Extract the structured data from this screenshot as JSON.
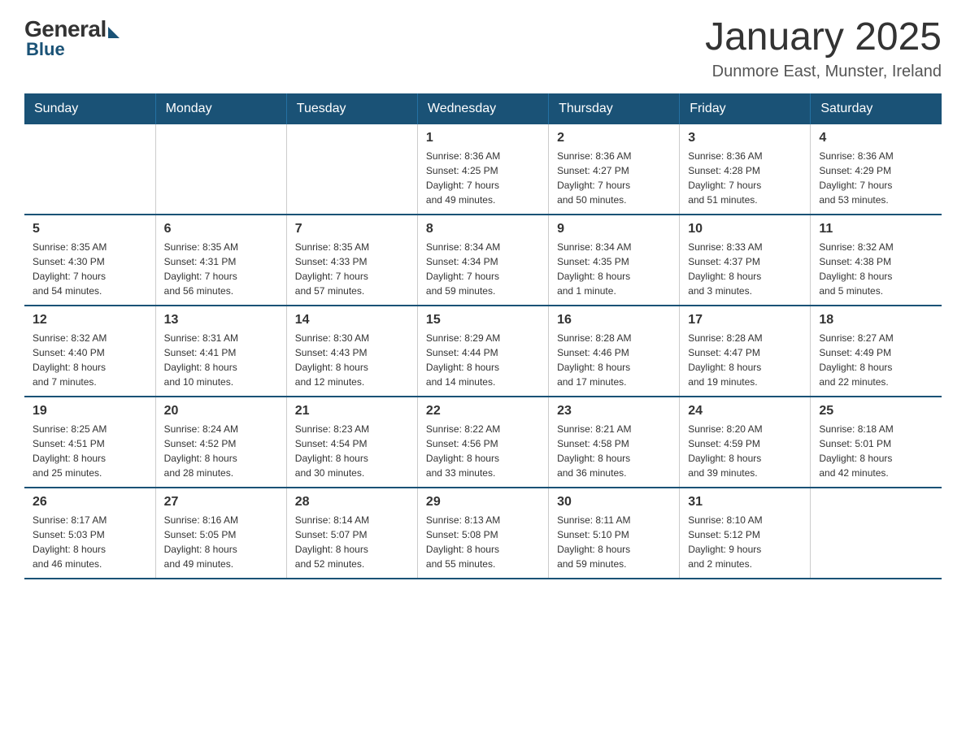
{
  "logo": {
    "general": "General",
    "blue": "Blue"
  },
  "title": "January 2025",
  "subtitle": "Dunmore East, Munster, Ireland",
  "days_of_week": [
    "Sunday",
    "Monday",
    "Tuesday",
    "Wednesday",
    "Thursday",
    "Friday",
    "Saturday"
  ],
  "weeks": [
    {
      "days": [
        {
          "num": "",
          "info": ""
        },
        {
          "num": "",
          "info": ""
        },
        {
          "num": "",
          "info": ""
        },
        {
          "num": "1",
          "info": "Sunrise: 8:36 AM\nSunset: 4:25 PM\nDaylight: 7 hours\nand 49 minutes."
        },
        {
          "num": "2",
          "info": "Sunrise: 8:36 AM\nSunset: 4:27 PM\nDaylight: 7 hours\nand 50 minutes."
        },
        {
          "num": "3",
          "info": "Sunrise: 8:36 AM\nSunset: 4:28 PM\nDaylight: 7 hours\nand 51 minutes."
        },
        {
          "num": "4",
          "info": "Sunrise: 8:36 AM\nSunset: 4:29 PM\nDaylight: 7 hours\nand 53 minutes."
        }
      ]
    },
    {
      "days": [
        {
          "num": "5",
          "info": "Sunrise: 8:35 AM\nSunset: 4:30 PM\nDaylight: 7 hours\nand 54 minutes."
        },
        {
          "num": "6",
          "info": "Sunrise: 8:35 AM\nSunset: 4:31 PM\nDaylight: 7 hours\nand 56 minutes."
        },
        {
          "num": "7",
          "info": "Sunrise: 8:35 AM\nSunset: 4:33 PM\nDaylight: 7 hours\nand 57 minutes."
        },
        {
          "num": "8",
          "info": "Sunrise: 8:34 AM\nSunset: 4:34 PM\nDaylight: 7 hours\nand 59 minutes."
        },
        {
          "num": "9",
          "info": "Sunrise: 8:34 AM\nSunset: 4:35 PM\nDaylight: 8 hours\nand 1 minute."
        },
        {
          "num": "10",
          "info": "Sunrise: 8:33 AM\nSunset: 4:37 PM\nDaylight: 8 hours\nand 3 minutes."
        },
        {
          "num": "11",
          "info": "Sunrise: 8:32 AM\nSunset: 4:38 PM\nDaylight: 8 hours\nand 5 minutes."
        }
      ]
    },
    {
      "days": [
        {
          "num": "12",
          "info": "Sunrise: 8:32 AM\nSunset: 4:40 PM\nDaylight: 8 hours\nand 7 minutes."
        },
        {
          "num": "13",
          "info": "Sunrise: 8:31 AM\nSunset: 4:41 PM\nDaylight: 8 hours\nand 10 minutes."
        },
        {
          "num": "14",
          "info": "Sunrise: 8:30 AM\nSunset: 4:43 PM\nDaylight: 8 hours\nand 12 minutes."
        },
        {
          "num": "15",
          "info": "Sunrise: 8:29 AM\nSunset: 4:44 PM\nDaylight: 8 hours\nand 14 minutes."
        },
        {
          "num": "16",
          "info": "Sunrise: 8:28 AM\nSunset: 4:46 PM\nDaylight: 8 hours\nand 17 minutes."
        },
        {
          "num": "17",
          "info": "Sunrise: 8:28 AM\nSunset: 4:47 PM\nDaylight: 8 hours\nand 19 minutes."
        },
        {
          "num": "18",
          "info": "Sunrise: 8:27 AM\nSunset: 4:49 PM\nDaylight: 8 hours\nand 22 minutes."
        }
      ]
    },
    {
      "days": [
        {
          "num": "19",
          "info": "Sunrise: 8:25 AM\nSunset: 4:51 PM\nDaylight: 8 hours\nand 25 minutes."
        },
        {
          "num": "20",
          "info": "Sunrise: 8:24 AM\nSunset: 4:52 PM\nDaylight: 8 hours\nand 28 minutes."
        },
        {
          "num": "21",
          "info": "Sunrise: 8:23 AM\nSunset: 4:54 PM\nDaylight: 8 hours\nand 30 minutes."
        },
        {
          "num": "22",
          "info": "Sunrise: 8:22 AM\nSunset: 4:56 PM\nDaylight: 8 hours\nand 33 minutes."
        },
        {
          "num": "23",
          "info": "Sunrise: 8:21 AM\nSunset: 4:58 PM\nDaylight: 8 hours\nand 36 minutes."
        },
        {
          "num": "24",
          "info": "Sunrise: 8:20 AM\nSunset: 4:59 PM\nDaylight: 8 hours\nand 39 minutes."
        },
        {
          "num": "25",
          "info": "Sunrise: 8:18 AM\nSunset: 5:01 PM\nDaylight: 8 hours\nand 42 minutes."
        }
      ]
    },
    {
      "days": [
        {
          "num": "26",
          "info": "Sunrise: 8:17 AM\nSunset: 5:03 PM\nDaylight: 8 hours\nand 46 minutes."
        },
        {
          "num": "27",
          "info": "Sunrise: 8:16 AM\nSunset: 5:05 PM\nDaylight: 8 hours\nand 49 minutes."
        },
        {
          "num": "28",
          "info": "Sunrise: 8:14 AM\nSunset: 5:07 PM\nDaylight: 8 hours\nand 52 minutes."
        },
        {
          "num": "29",
          "info": "Sunrise: 8:13 AM\nSunset: 5:08 PM\nDaylight: 8 hours\nand 55 minutes."
        },
        {
          "num": "30",
          "info": "Sunrise: 8:11 AM\nSunset: 5:10 PM\nDaylight: 8 hours\nand 59 minutes."
        },
        {
          "num": "31",
          "info": "Sunrise: 8:10 AM\nSunset: 5:12 PM\nDaylight: 9 hours\nand 2 minutes."
        },
        {
          "num": "",
          "info": ""
        }
      ]
    }
  ]
}
